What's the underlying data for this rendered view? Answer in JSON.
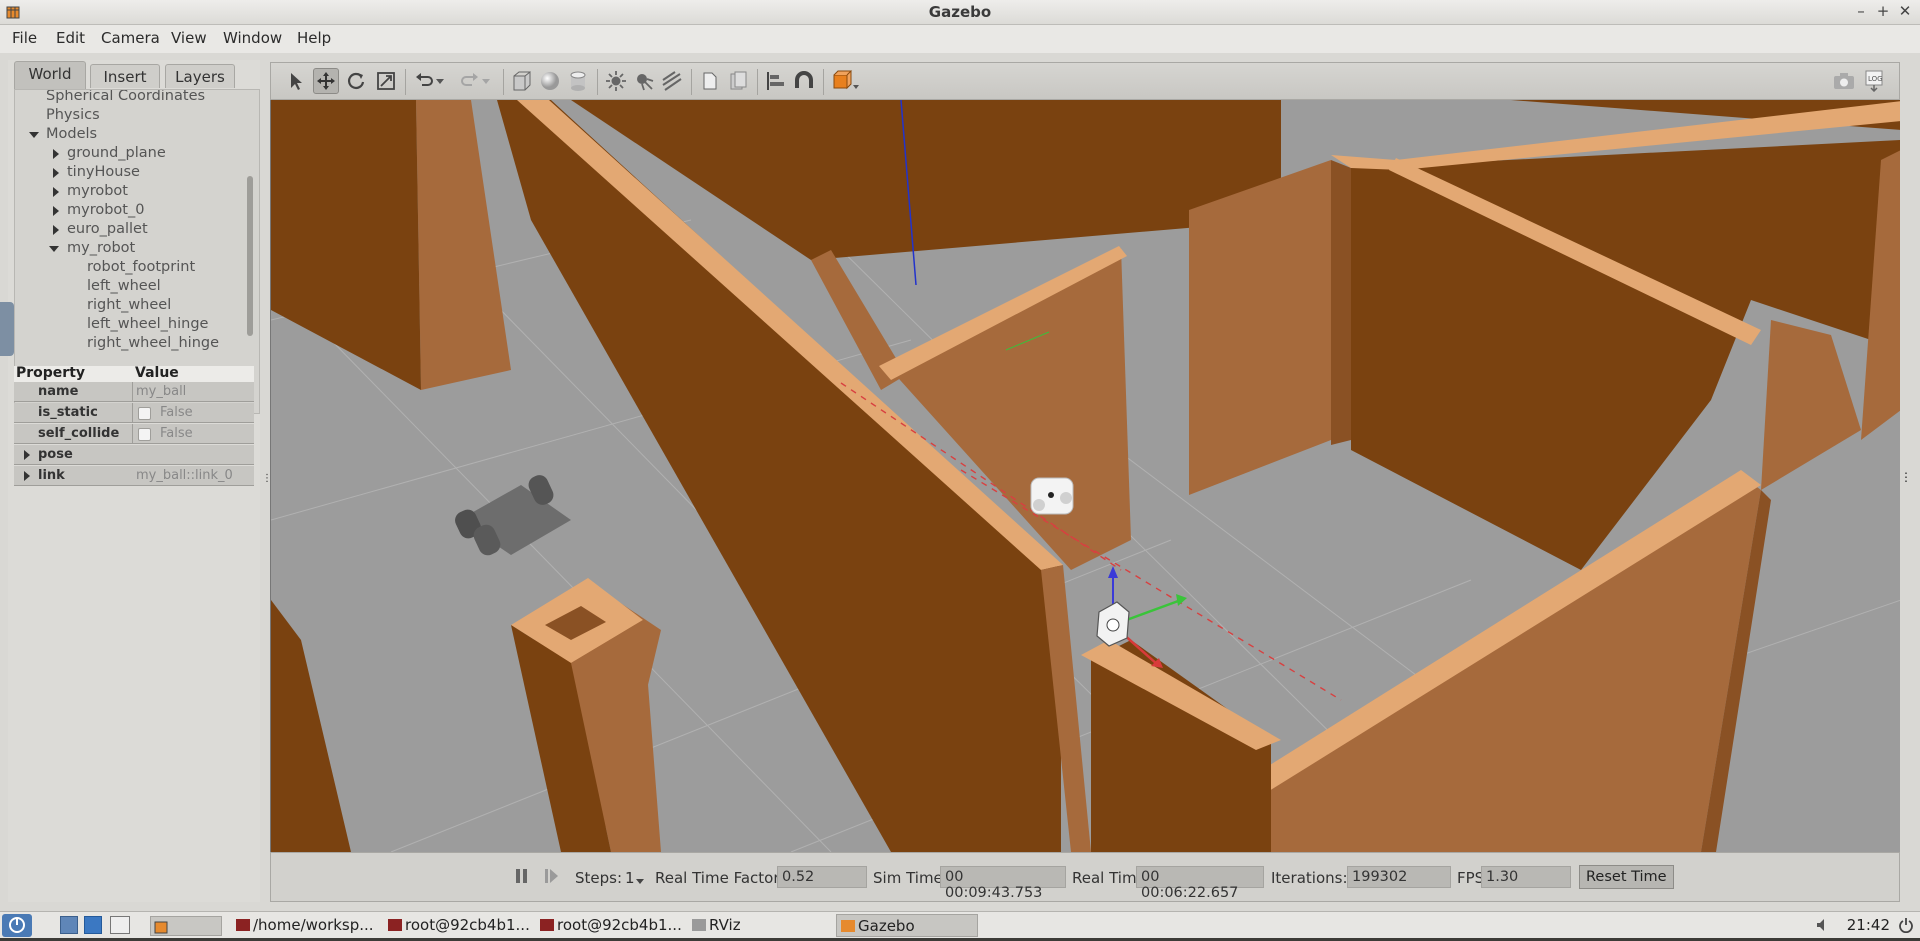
{
  "window": {
    "title": "Gazebo"
  },
  "menu": [
    "File",
    "Edit",
    "Camera",
    "View",
    "Window",
    "Help"
  ],
  "tabs": [
    "World",
    "Insert",
    "Layers"
  ],
  "tree": {
    "top_items": [
      "Spherical Coordinates",
      "Physics",
      "Models"
    ],
    "models": [
      "ground_plane",
      "tinyHouse",
      "myrobot",
      "myrobot_0",
      "euro_pallet",
      "my_robot"
    ],
    "my_robot_children": [
      "robot_footprint",
      "left_wheel",
      "right_wheel",
      "left_wheel_hinge",
      "right_wheel_hinge"
    ]
  },
  "properties": {
    "header_property": "Property",
    "header_value": "Value",
    "rows": [
      {
        "key": "name",
        "value": "my_ball"
      },
      {
        "key": "is_static",
        "value": "False"
      },
      {
        "key": "self_collide",
        "value": "False"
      },
      {
        "key": "pose",
        "value": ""
      },
      {
        "key": "link",
        "value": "my_ball::link_0"
      }
    ]
  },
  "toolbar_icons": [
    "select-arrow-icon",
    "translate-icon",
    "rotate-icon",
    "scale-icon",
    "undo-icon",
    "undo-dropdown-icon",
    "redo-icon",
    "redo-dropdown-icon",
    "box-icon",
    "sphere-icon",
    "cylinder-icon",
    "point-light-icon",
    "spot-light-icon",
    "directional-light-icon",
    "copy-icon",
    "paste-icon",
    "align-icon",
    "snap-icon",
    "view-angle-icon",
    "screenshot-icon",
    "log-icon"
  ],
  "status": {
    "steps_label": "Steps:",
    "steps_value": "1",
    "rtf_label": "Real Time Factor:",
    "rtf_value": "0.52",
    "sim_label": "Sim Time:",
    "sim_value": "00 00:09:43.753",
    "real_label": "Real Time:",
    "real_value": "00 00:06:22.657",
    "iter_label": "Iterations:",
    "iter_value": "199302",
    "fps_label": "FPS:",
    "fps_value": "1.30",
    "reset_label": "Reset Time"
  },
  "taskbar": {
    "tasks": [
      "/home/worksp...",
      "root@92cb4b1...",
      "root@92cb4b1...",
      "RViz",
      "Gazebo"
    ],
    "clock": "21:42"
  },
  "colors": {
    "wall_dark": "#7a4210",
    "wall_mid": "#a96d3f",
    "wall_top": "#e0a874",
    "floor": "#9a9a9a"
  }
}
